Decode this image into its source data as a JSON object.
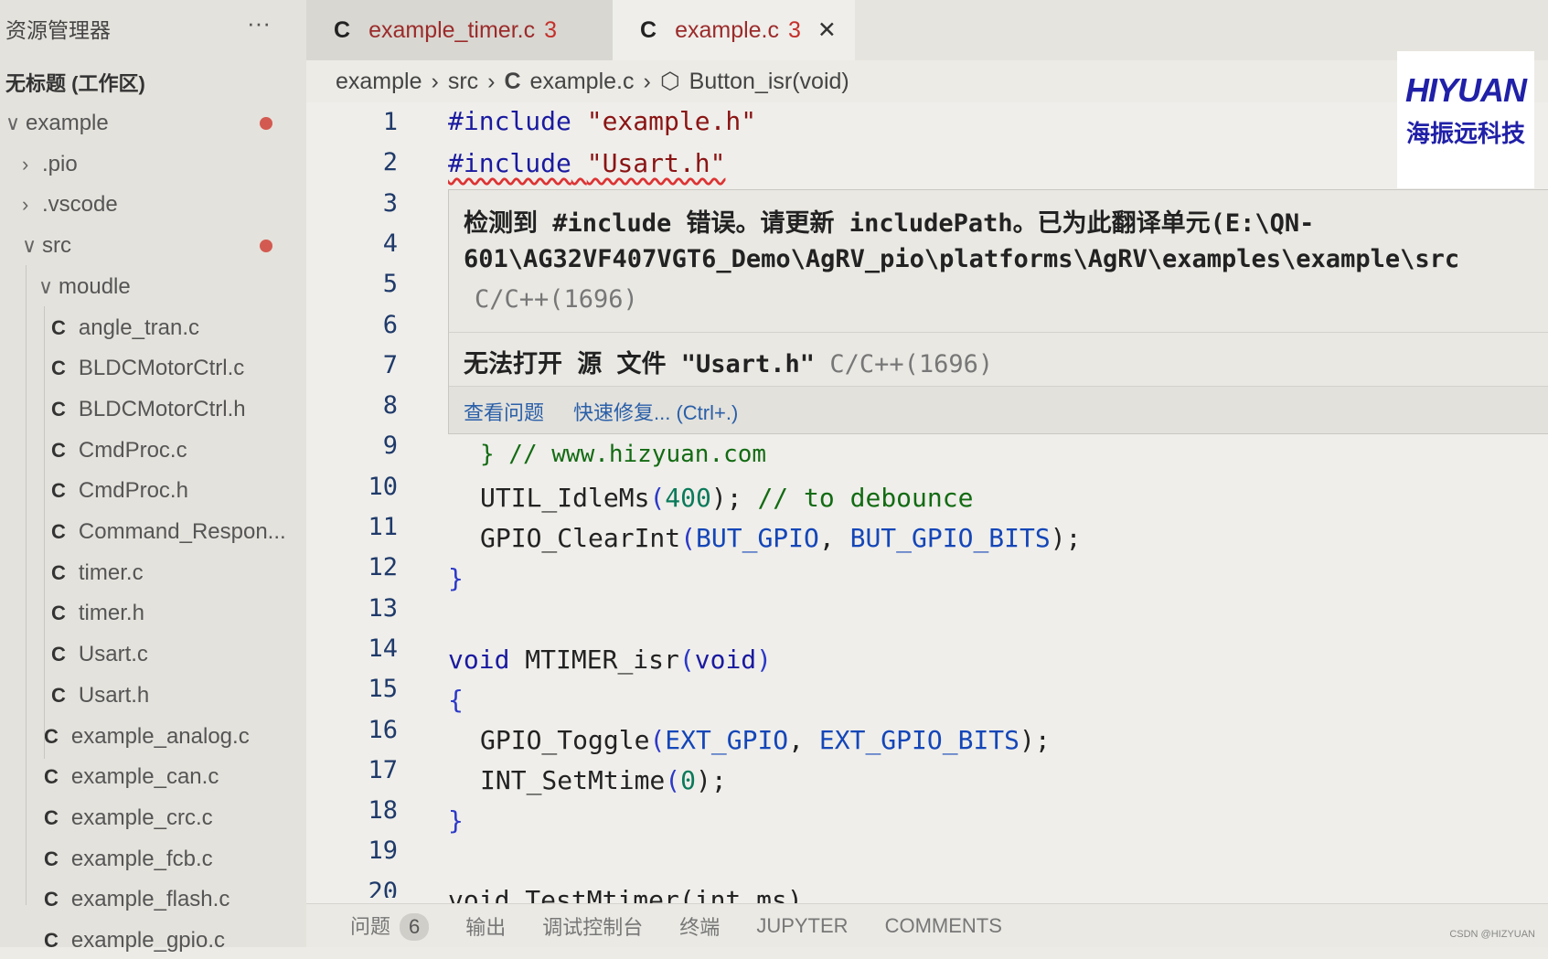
{
  "sidebar": {
    "title": "资源管理器",
    "more": "···",
    "workspace": "无标题 (工作区)",
    "items": [
      {
        "label": "example",
        "chev": "∨",
        "level": 0,
        "dot": true
      },
      {
        "label": ".pio",
        "chev": "›",
        "level": 1
      },
      {
        "label": ".vscode",
        "chev": "›",
        "level": 1
      },
      {
        "label": "src",
        "chev": "∨",
        "level": 1,
        "dot": true
      },
      {
        "label": "moudle",
        "chev": "∨",
        "level": 2
      },
      {
        "label": "angle_tran.c",
        "c": true,
        "level": 3
      },
      {
        "label": "BLDCMotorCtrl.c",
        "c": true,
        "level": 3
      },
      {
        "label": "BLDCMotorCtrl.h",
        "c": true,
        "level": 3
      },
      {
        "label": "CmdProc.c",
        "c": true,
        "level": 3
      },
      {
        "label": "CmdProc.h",
        "c": true,
        "level": 3
      },
      {
        "label": "Command_Respon...",
        "c": true,
        "level": 3
      },
      {
        "label": "timer.c",
        "c": true,
        "level": 3
      },
      {
        "label": "timer.h",
        "c": true,
        "level": 3
      },
      {
        "label": "Usart.c",
        "c": true,
        "level": 3
      },
      {
        "label": "Usart.h",
        "c": true,
        "level": 3
      },
      {
        "label": "example_analog.c",
        "c": true,
        "level": 2
      },
      {
        "label": "example_can.c",
        "c": true,
        "level": 2
      },
      {
        "label": "example_crc.c",
        "c": true,
        "level": 2
      },
      {
        "label": "example_fcb.c",
        "c": true,
        "level": 2
      },
      {
        "label": "example_flash.c",
        "c": true,
        "level": 2
      },
      {
        "label": "example_gpio.c",
        "c": true,
        "level": 2
      }
    ]
  },
  "tabs": [
    {
      "icon": "C",
      "label": "example_timer.c",
      "count": "3"
    },
    {
      "icon": "C",
      "label": "example.c",
      "count": "3",
      "close": "✕"
    }
  ],
  "breadcrumb": [
    "example",
    "src",
    "example.c",
    "Button_isr(void)"
  ],
  "line_numbers": [
    "1",
    "2",
    "3",
    "4",
    "5",
    "6",
    "7",
    "8",
    "9",
    "10",
    "11",
    "12",
    "13",
    "14",
    "15",
    "16",
    "17",
    "18",
    "19",
    "20"
  ],
  "code": {
    "l1": [
      "#include",
      "\"example.h\""
    ],
    "l2": [
      "#include",
      "\"Usart.h\""
    ],
    "l9": "} // www.hizyuan.com",
    "l10": [
      "UTIL_IdleMs",
      "(",
      "400",
      ");",
      "// to debounce"
    ],
    "l11": [
      "GPIO_ClearInt",
      "(",
      "BUT_GPIO",
      ", ",
      "BUT_GPIO_BITS",
      ");"
    ],
    "l12": "}",
    "l14": [
      "void ",
      "MTIMER_isr",
      "(",
      "void",
      ")"
    ],
    "l15": "{",
    "l16": [
      "GPIO_Toggle",
      "(",
      "EXT_GPIO",
      ", ",
      "EXT_GPIO_BITS",
      ");"
    ],
    "l17": [
      "INT_SetMtime",
      "(",
      "0",
      ");"
    ],
    "l18": "}",
    "l20": "void TestMtimer(int ms)"
  },
  "hover": {
    "msg1a": "检测到 #include 错误。请更新 includePath。已为此翻译单元(E:\\QN-",
    "msg1b": "601\\AG32VF407VGT6_Demo\\AgRV_pio\\platforms\\AgRV\\examples\\example\\src",
    "src1": "C/C++(1696)",
    "msg2": "无法打开 源 文件 \"Usart.h\"",
    "src2": "C/C++(1696)",
    "action_view": "查看问题",
    "action_fix": "快速修复... (Ctrl+.)"
  },
  "logo": {
    "text": "HIYUAN",
    "subtitle": "海振远科技"
  },
  "panel": {
    "tabs": [
      "问题",
      "输出",
      "调试控制台",
      "终端",
      "JUPYTER",
      "COMMENTS"
    ],
    "problems_count": "6"
  },
  "watermark": "CSDN @HIZYUAN",
  "colors": {
    "keyword": "#1a1aa0",
    "string": "#8a1414",
    "comment": "#136b13",
    "error": "#c4302b"
  }
}
